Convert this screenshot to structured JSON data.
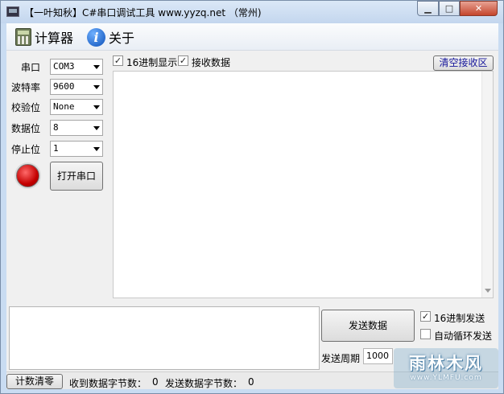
{
  "window": {
    "title": "【一叶知秋】C#串口调试工具 www.yyzq.net （常州)",
    "minimize_glyph": "▁",
    "maximize_glyph": "□",
    "close_glyph": "✕"
  },
  "menu": {
    "calculator": {
      "label": "计算器",
      "icon": "calculator-icon"
    },
    "about": {
      "label": "关于",
      "icon": "info-icon",
      "glyph": "i"
    }
  },
  "settings": {
    "port": {
      "label": "串口",
      "value": "COM3"
    },
    "baud_rate": {
      "label": "波特率",
      "value": "9600"
    },
    "parity": {
      "label": "校验位",
      "value": "None"
    },
    "data_bits": {
      "label": "数据位",
      "value": "8"
    },
    "stop_bits": {
      "label": "停止位",
      "value": "1"
    },
    "status_led_color": "#d40000",
    "open_button": "打开串口"
  },
  "receive": {
    "hex_display": {
      "label": "16进制显示",
      "checked": true
    },
    "receive_data": {
      "label": "接收数据",
      "checked": true
    },
    "clear_button": "清空接收区",
    "content": ""
  },
  "send": {
    "content": "",
    "send_button": "发送数据",
    "hex_send": {
      "label": "16进制发送",
      "checked": true
    },
    "auto_loop": {
      "label": "自动循环发送",
      "checked": false
    },
    "period_label": "发送周期",
    "period_value": "1000"
  },
  "status": {
    "reset_button": "计数清零",
    "received_label": "收到数据字节数：",
    "received_count": "0",
    "sent_label": "发送数据字节数：",
    "sent_count": "0"
  },
  "watermark": {
    "main": "雨林木风",
    "url": "www.YLMFU.com"
  },
  "check_glyph": "✓"
}
